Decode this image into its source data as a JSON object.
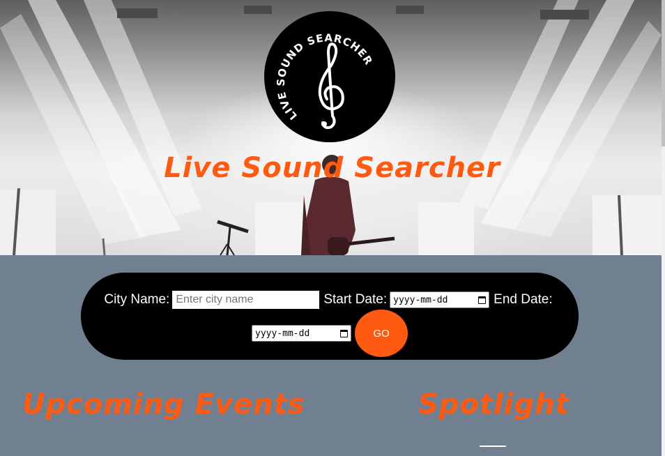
{
  "hero": {
    "title": "Live Sound Searcher",
    "logo_text": "LIVE SOUND SEARCHER",
    "logo_icon": "treble-clef-icon"
  },
  "search": {
    "city_label": "City Name:",
    "city_placeholder": "Enter city name",
    "start_label": "Start Date:",
    "start_value": "yyyy-mm-dd",
    "end_label": "End Date:",
    "end_value": "yyyy-mm-dd",
    "go_label": "GO"
  },
  "sections": {
    "upcoming": "Upcoming Events",
    "spotlight": "Spotlight"
  },
  "colors": {
    "accent": "#ff5a12",
    "background": "#708090",
    "pill": "#000000"
  }
}
